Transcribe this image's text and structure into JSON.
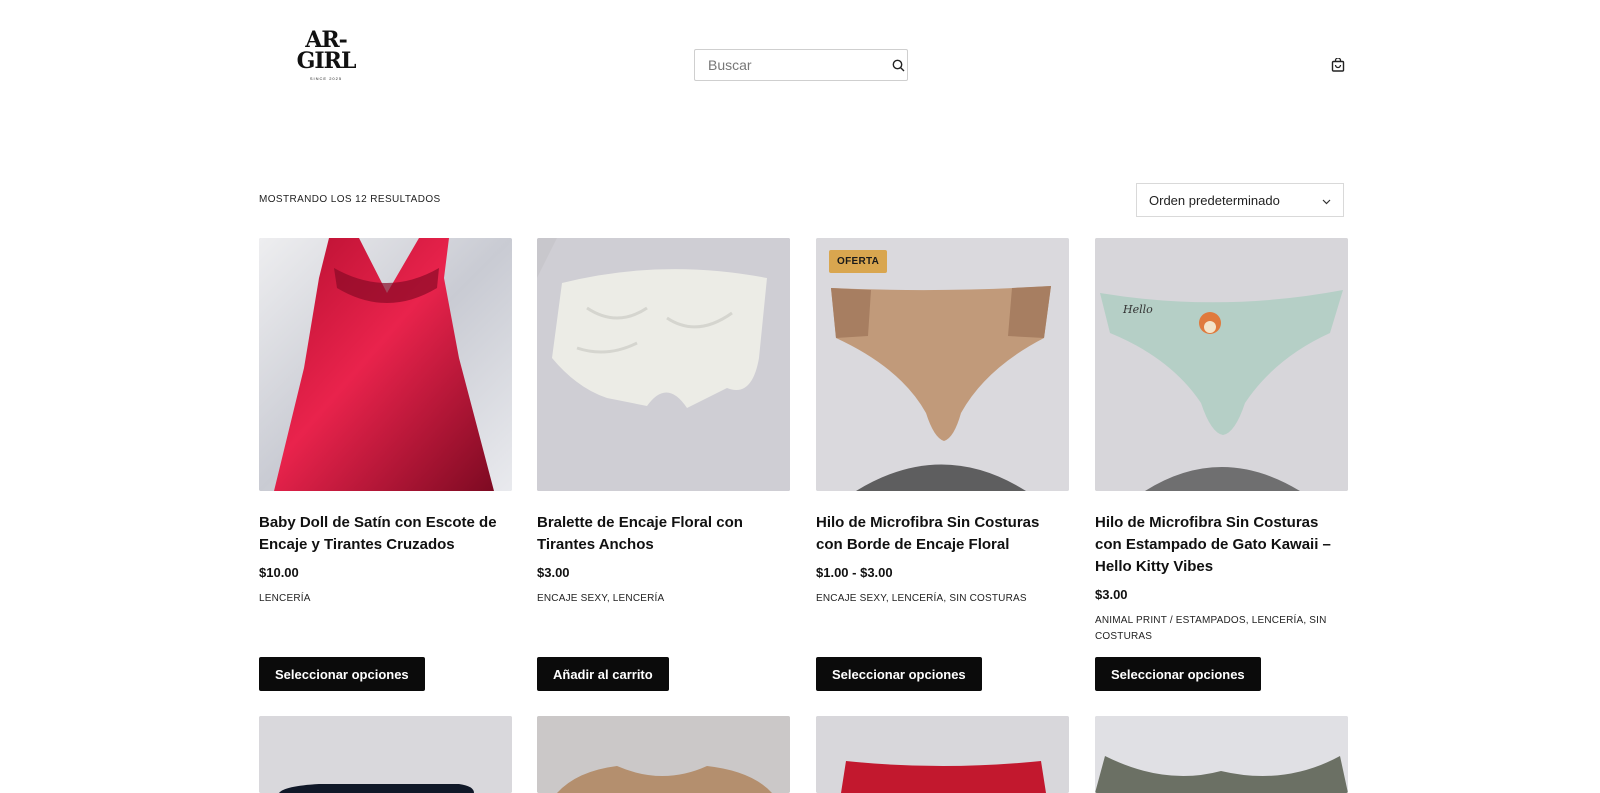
{
  "header": {
    "logo_text_line1": "AR-",
    "logo_text_line2": "GIRL",
    "logo_tagline": "SINCE 2025",
    "search_placeholder": "Buscar"
  },
  "toolbar": {
    "results_text": "MOSTRANDO LOS 12 RESULTADOS",
    "sort_selected": "Orden predeterminado"
  },
  "products": [
    {
      "title": "Baby Doll de Satín con Escote de Encaje y Tirantes Cruzados",
      "price": "$10.00",
      "categories": "LENCERÍA",
      "button": "Seleccionar opciones"
    },
    {
      "title": "Bralette de Encaje Floral con Tirantes Anchos",
      "price": "$3.00",
      "categories": "ENCAJE SEXY, LENCERÍA",
      "button": "Añadir al carrito"
    },
    {
      "title": "Hilo de Microfibra Sin Costuras con Borde de Encaje Floral",
      "price": "$1.00 - $3.00",
      "categories": "ENCAJE SEXY, LENCERÍA, SIN COSTURAS",
      "button": "Seleccionar opciones",
      "badge": "OFERTA"
    },
    {
      "title": "Hilo de Microfibra Sin Costuras con Estampado de Gato Kawaii – Hello Kitty Vibes",
      "price": "$3.00",
      "categories": "ANIMAL PRINT / ESTAMPADOS, LENCERÍA, SIN COSTURAS",
      "button": "Seleccionar opciones",
      "print_text": "Hello"
    }
  ],
  "colors": {
    "button_bg": "#0b0b0b",
    "badge_bg": "#d9a64f"
  }
}
